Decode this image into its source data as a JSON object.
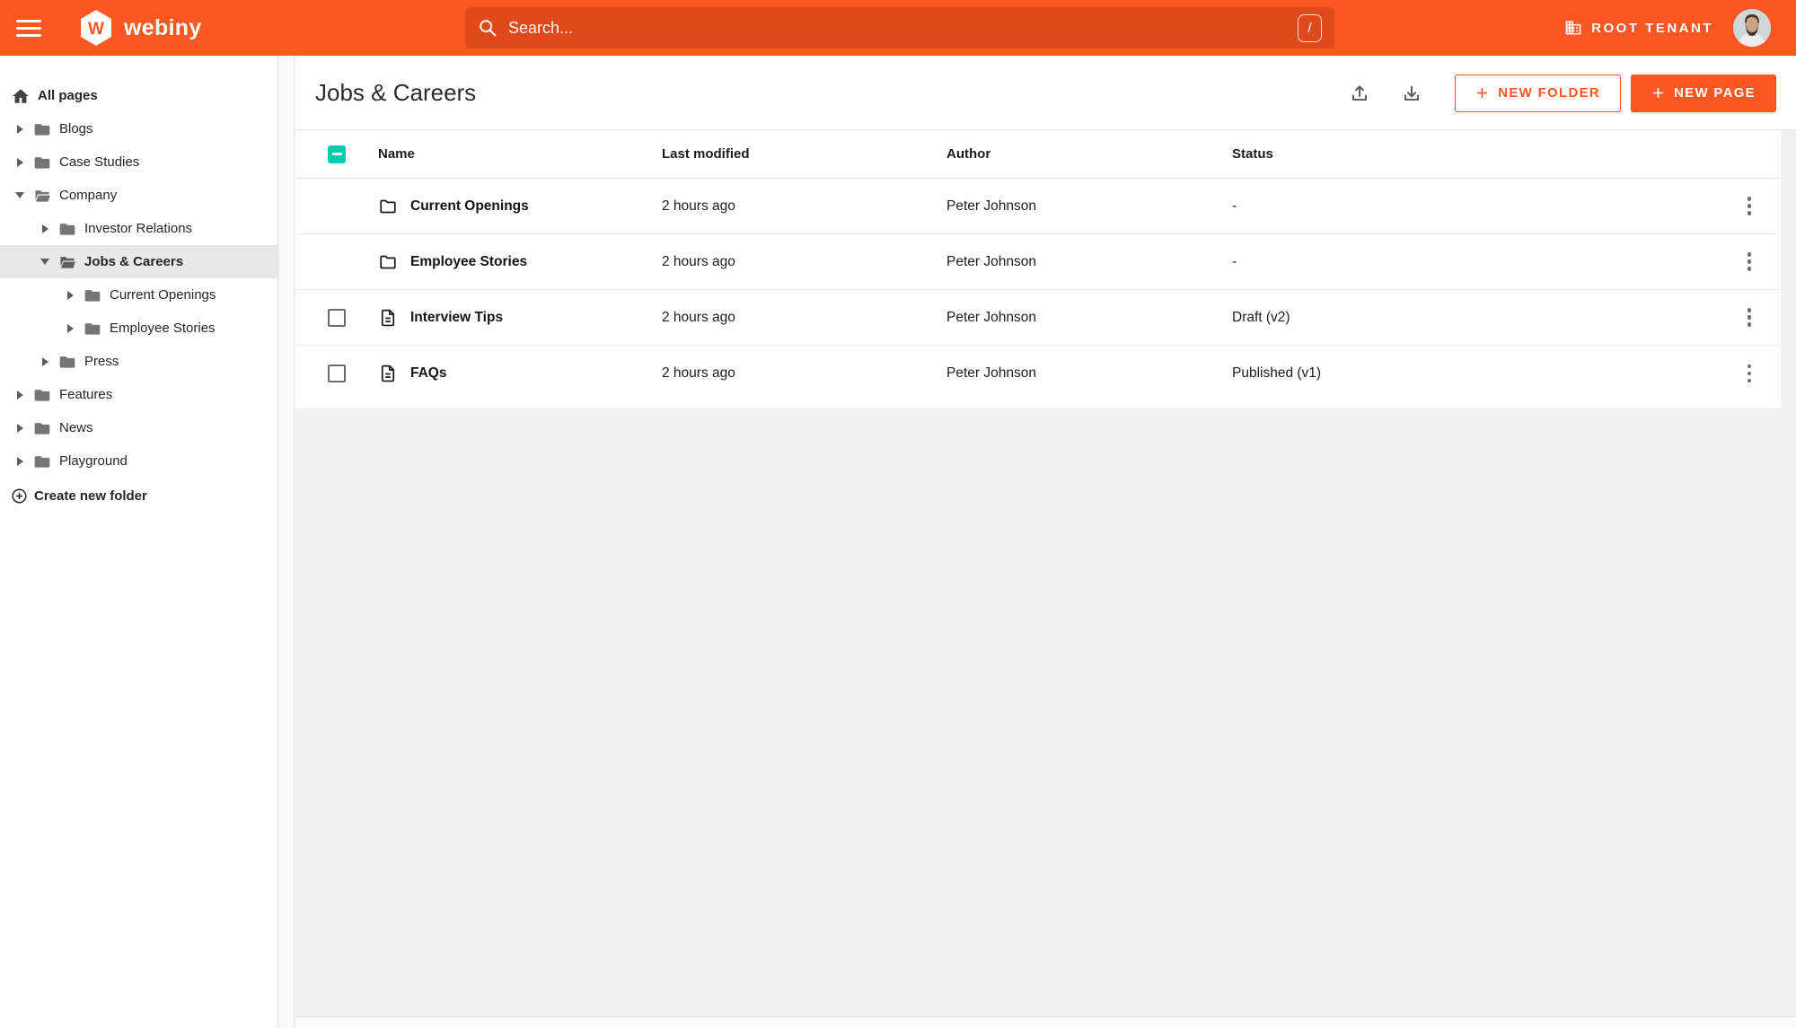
{
  "topbar": {
    "brand": "webiny",
    "search": {
      "placeholder": "Search...",
      "shortcut": "/"
    },
    "tenant": "ROOT TENANT"
  },
  "sidebar": {
    "root_label": "All pages",
    "items": [
      {
        "label": "Blogs",
        "level": 0,
        "state": "collapsed"
      },
      {
        "label": "Case Studies",
        "level": 0,
        "state": "collapsed"
      },
      {
        "label": "Company",
        "level": 0,
        "state": "expanded"
      },
      {
        "label": "Investor Relations",
        "level": 1,
        "state": "collapsed"
      },
      {
        "label": "Jobs & Careers",
        "level": 1,
        "state": "expanded",
        "selected": true
      },
      {
        "label": "Current Openings",
        "level": 2,
        "state": "collapsed"
      },
      {
        "label": "Employee Stories",
        "level": 2,
        "state": "collapsed"
      },
      {
        "label": "Press",
        "level": 1,
        "state": "collapsed"
      },
      {
        "label": "Features",
        "level": 0,
        "state": "collapsed"
      },
      {
        "label": "News",
        "level": 0,
        "state": "collapsed"
      },
      {
        "label": "Playground",
        "level": 0,
        "state": "collapsed"
      }
    ],
    "create_folder_label": "Create new folder"
  },
  "main": {
    "title": "Jobs & Careers",
    "buttons": {
      "new_folder": "NEW FOLDER",
      "new_page": "NEW PAGE"
    },
    "table": {
      "headers": {
        "name": "Name",
        "modified": "Last modified",
        "author": "Author",
        "status": "Status"
      },
      "rows": [
        {
          "type": "folder",
          "name": "Current Openings",
          "modified": "2 hours ago",
          "author": "Peter Johnson",
          "status": "-"
        },
        {
          "type": "folder",
          "name": "Employee Stories",
          "modified": "2 hours ago",
          "author": "Peter Johnson",
          "status": "-"
        },
        {
          "type": "page",
          "name": "Interview Tips",
          "modified": "2 hours ago",
          "author": "Peter Johnson",
          "status": "Draft (v2)"
        },
        {
          "type": "page",
          "name": "FAQs",
          "modified": "2 hours ago",
          "author": "Peter Johnson",
          "status": "Published (v1)"
        }
      ]
    }
  },
  "colors": {
    "primary": "#fa5723",
    "search_field": "#de4a1b",
    "checkbox_teal": "#00ccb0"
  }
}
